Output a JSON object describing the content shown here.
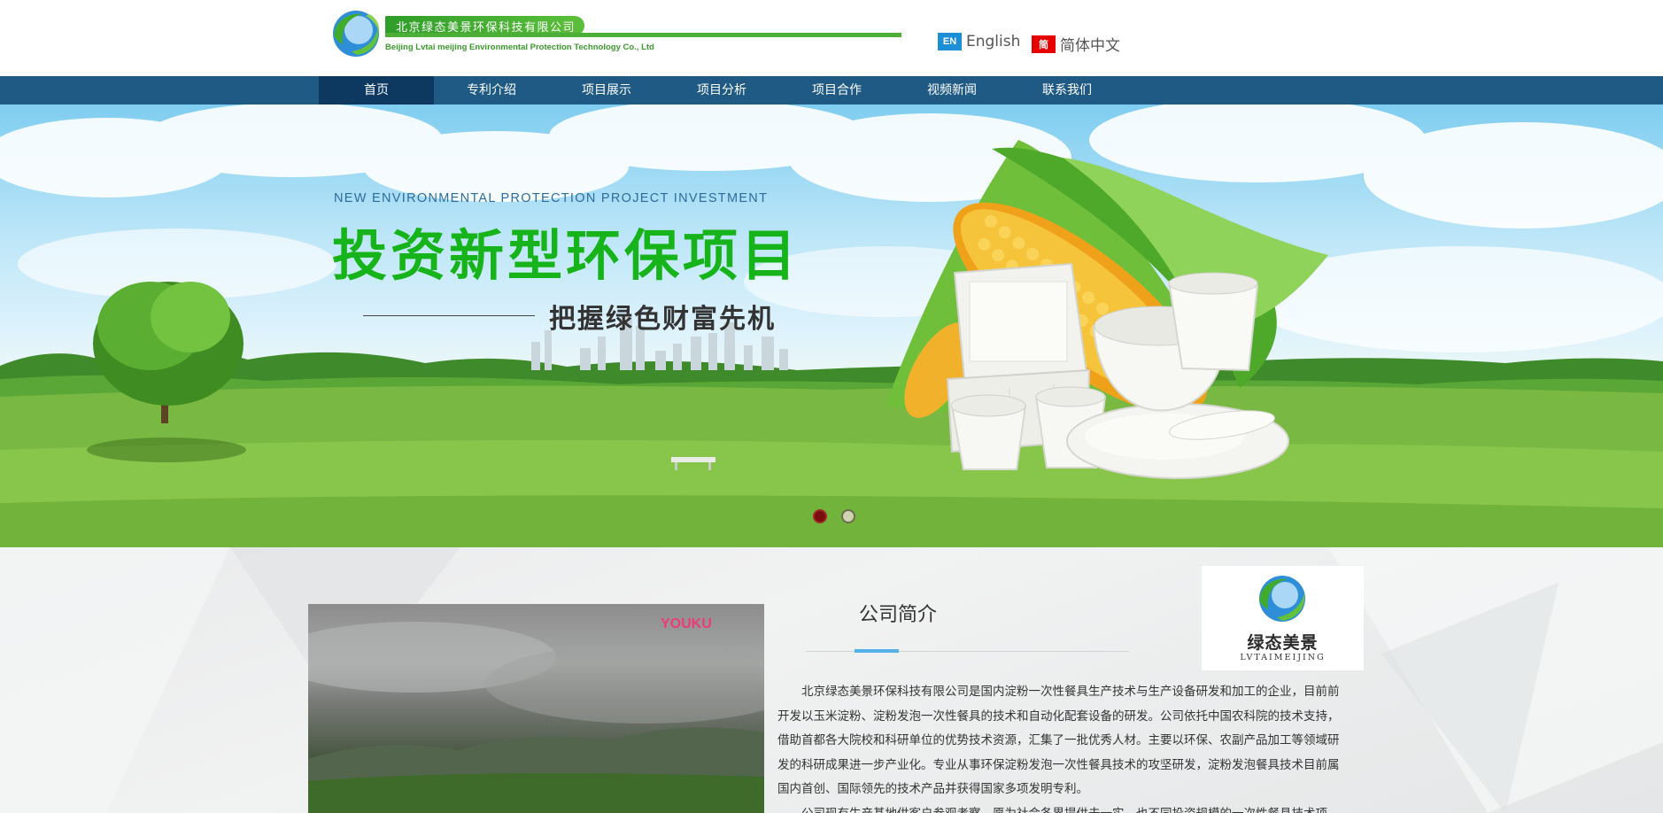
{
  "header": {
    "logo": {
      "company_cn": "北京绿态美景环保科技有限公司",
      "company_en": "Beijing Lvtai meijing Environmental Protection Technology Co., Ltd"
    },
    "languages": [
      {
        "flag": "EN",
        "label": "English",
        "color": "#1d8fd6"
      },
      {
        "flag": "简",
        "label": "简体中文",
        "color": "#e60000"
      }
    ]
  },
  "nav": {
    "items": [
      "首页",
      "专利介绍",
      "项目展示",
      "项目分析",
      "项目合作",
      "视频新闻",
      "联系我们"
    ],
    "active_index": 0,
    "bg_color": "#1e5a83",
    "active_color": "#0d3960"
  },
  "banner": {
    "subtitle_en": "NEW ENVIRONMENTAL PROTECTION PROJECT INVESTMENT",
    "title": "投资新型环保项目",
    "tagline": "把握绿色财富先机",
    "title_color": "#17b31a",
    "slides_total": 2,
    "active_slide": 1
  },
  "about": {
    "video_brand": "YOUKU",
    "title": "公司简介",
    "brand_card": {
      "cn": "绿态美景",
      "en": "LVTAIMEIJING"
    },
    "paragraphs": [
      "北京绿态美景环保科技有限公司是国内淀粉一次性餐具生产技术与生产设备研发和加工的企业，目前前开发以玉米淀粉、淀粉发泡一次性餐具的技术和自动化配套设备的研发。公司依托中国农科院的技术支持，借助首都各大院校和科研单位的优势技术资源，汇集了一批优秀人材。主要以环保、农副产品加工等领域研发的科研成果进一步产业化。专业从事环保淀粉发泡一次性餐具技术的攻坚研发，淀粉发泡餐具技术目前属国内首创、国际领先的技术产品并获得国家多项发明专利。",
      "公司现有生产基地供客户参观考察，愿为社会各界提供去一实，也不同投资规模的一次性餐具技术项"
    ],
    "accent_color": "#53b0e8"
  }
}
